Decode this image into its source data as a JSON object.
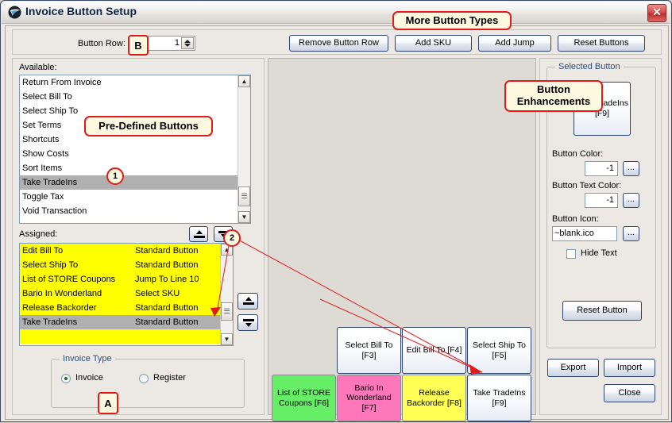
{
  "window": {
    "title": "Invoice Button Setup",
    "icon": "app-swoosh-icon",
    "close_label": "✕"
  },
  "toolbar": {
    "button_row_label": "Button Row:",
    "button_row_value": "1",
    "buttons": [
      {
        "label": "Remove Button Row"
      },
      {
        "label": "Add SKU"
      },
      {
        "label": "Add Jump"
      },
      {
        "label": "Reset Buttons"
      }
    ]
  },
  "available": {
    "label": "Available:",
    "items": [
      {
        "name": "Return From Invoice",
        "selected": false
      },
      {
        "name": "Select Bill To",
        "selected": false
      },
      {
        "name": "Select Ship To",
        "selected": false
      },
      {
        "name": "Set Terms",
        "selected": false
      },
      {
        "name": "Shortcuts",
        "selected": false
      },
      {
        "name": "Show Costs",
        "selected": false
      },
      {
        "name": "Sort Items",
        "selected": false
      },
      {
        "name": "Take TradeIns",
        "selected": true
      },
      {
        "name": "Toggle Tax",
        "selected": false
      },
      {
        "name": "Void Transaction",
        "selected": false
      }
    ]
  },
  "assigned": {
    "label": "Assigned:",
    "items": [
      {
        "name": "Edit Bill To",
        "type": "Standard Button",
        "selected": false
      },
      {
        "name": "Select Ship To",
        "type": "Standard Button",
        "selected": false
      },
      {
        "name": "List of STORE Coupons",
        "type": "Jump To Line 10",
        "selected": false
      },
      {
        "name": "Bario In Wonderland",
        "type": "Select SKU",
        "selected": false
      },
      {
        "name": "Release Backorder",
        "type": "Standard Button",
        "selected": false
      },
      {
        "name": "Take TradeIns",
        "type": "Standard Button",
        "selected": true
      },
      {
        "name": "",
        "type": "",
        "selected": false
      }
    ]
  },
  "invoice_type": {
    "title": "Invoice Type",
    "options": [
      {
        "label": "Invoice",
        "checked": true
      },
      {
        "label": "Register",
        "checked": false
      }
    ]
  },
  "button_grid": {
    "row1": [
      {
        "label": "Select Bill To [F3]",
        "bg": "#f4f7fc"
      },
      {
        "label": "Edit Bill To [F4]",
        "bg": "#f4f7fc"
      },
      {
        "label": "Select Ship To [F5]",
        "bg": "#f4f7fc"
      }
    ],
    "row2": [
      {
        "label": "List of STORE Coupons [F6]",
        "bg": "#66ef66"
      },
      {
        "label": "Bario In Wonderland [F7]",
        "bg": "#ff77bb"
      },
      {
        "label": "Release Backorder [F8]",
        "bg": "#ffff55"
      },
      {
        "label": "Take TradeIns [F9]",
        "bg": "#f4f7fc"
      }
    ]
  },
  "selected_button": {
    "group_title": "Selected Button",
    "preview_label": "Take TradeIns [F9]",
    "button_color_label": "Button Color:",
    "button_color_value": "-1",
    "button_text_color_label": "Button Text Color:",
    "button_text_color_value": "-1",
    "button_icon_label": "Button Icon:",
    "button_icon_value": "~blank.ico",
    "ellipsis_label": "...",
    "hide_text_label": "Hide Text",
    "hide_text_checked": false,
    "reset_button_label": "Reset Button"
  },
  "footer": {
    "export_label": "Export",
    "import_label": "Import",
    "close_label": "Close"
  },
  "annotations": {
    "more_button_types": "More Button Types",
    "pre_defined_buttons": "Pre-Defined Buttons",
    "button_enhancements": "Button\nEnhancements",
    "badge_1": "1",
    "badge_2": "2",
    "mark_a": "A",
    "mark_b": "B",
    "accent": "#e01b1b"
  }
}
